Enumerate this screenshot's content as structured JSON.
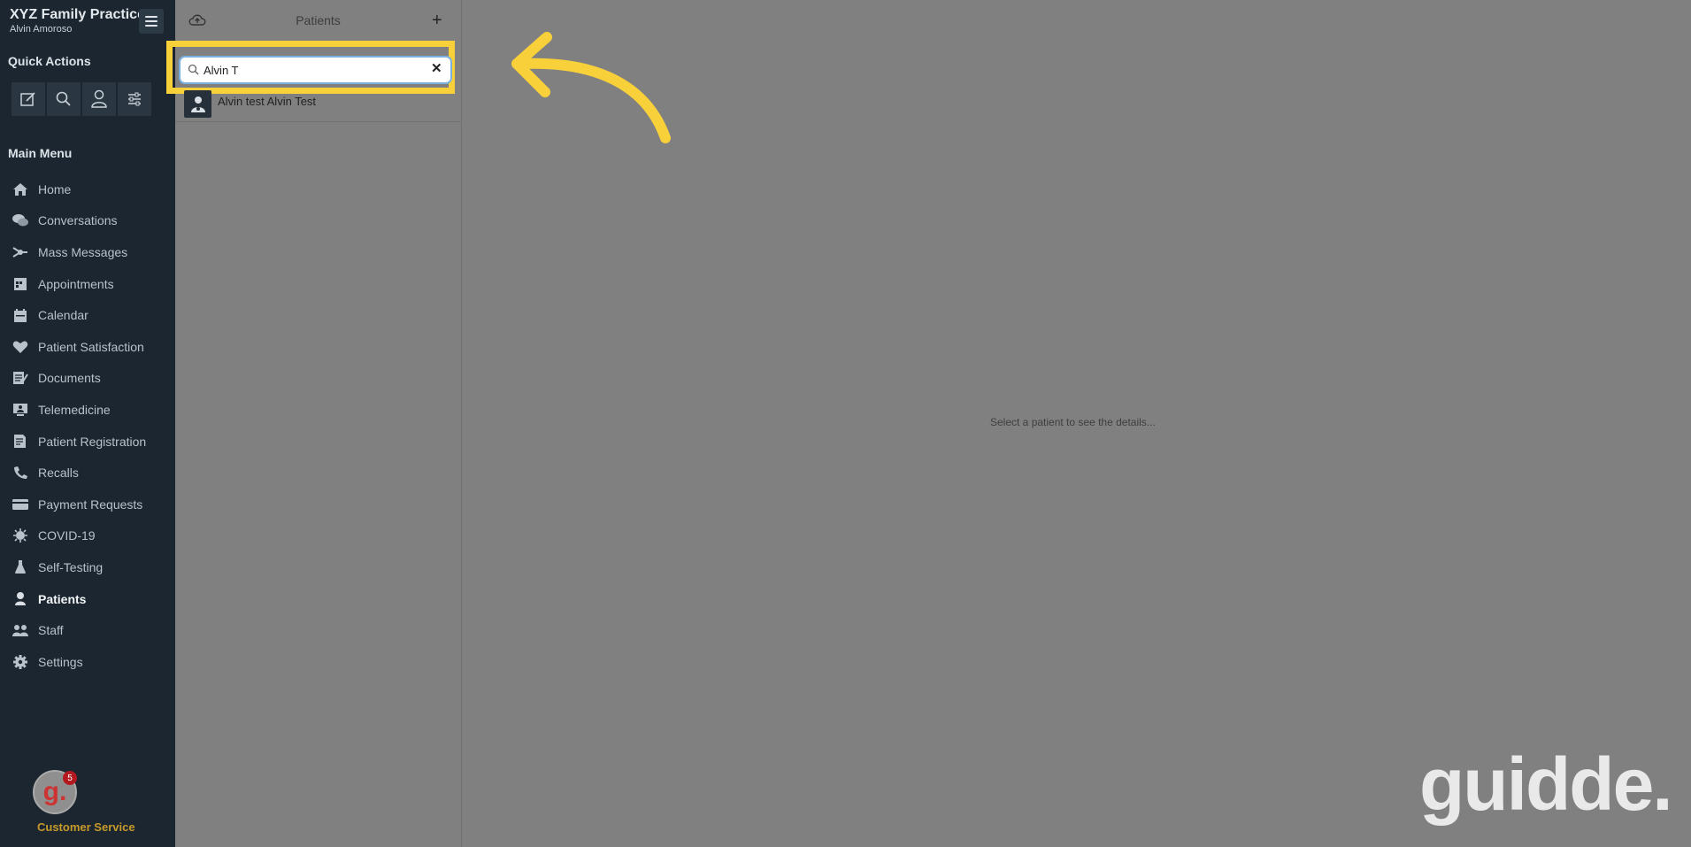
{
  "practice": {
    "name": "XYZ Family Practice",
    "user": "Alvin Amoroso"
  },
  "quick_actions": {
    "title": "Quick Actions",
    "icons": [
      "compose-icon",
      "search-icon",
      "patient-icon",
      "settings-sliders-icon"
    ]
  },
  "main_menu": {
    "title": "Main Menu",
    "items": [
      {
        "label": "Home",
        "icon": "home-icon"
      },
      {
        "label": "Conversations",
        "icon": "conversations-icon"
      },
      {
        "label": "Mass Messages",
        "icon": "mass-messages-icon"
      },
      {
        "label": "Appointments",
        "icon": "appointments-icon"
      },
      {
        "label": "Calendar",
        "icon": "calendar-icon"
      },
      {
        "label": "Patient Satisfaction",
        "icon": "heart-icon"
      },
      {
        "label": "Documents",
        "icon": "documents-icon"
      },
      {
        "label": "Telemedicine",
        "icon": "telemedicine-icon"
      },
      {
        "label": "Patient Registration",
        "icon": "registration-icon"
      },
      {
        "label": "Recalls",
        "icon": "phone-icon"
      },
      {
        "label": "Payment Requests",
        "icon": "credit-card-icon"
      },
      {
        "label": "COVID-19",
        "icon": "virus-icon"
      },
      {
        "label": "Self-Testing",
        "icon": "flask-icon"
      },
      {
        "label": "Patients",
        "icon": "patient-icon",
        "active": true
      },
      {
        "label": "Staff",
        "icon": "staff-icon"
      },
      {
        "label": "Settings",
        "icon": "gear-icon"
      }
    ]
  },
  "customer_service": {
    "label": "Customer Service",
    "badge": "5",
    "logo_letter": "g."
  },
  "patients_panel": {
    "title": "Patients",
    "add_label": "+",
    "search": {
      "value": "Alvin T",
      "clear_label": "✕"
    },
    "results": [
      {
        "name": "Alvin test Alvin Test"
      }
    ]
  },
  "detail_panel": {
    "empty_text": "Select a patient to see the details..."
  },
  "watermark": "guidde.",
  "colors": {
    "sidebar": "#1b2630",
    "overlay": "#808080",
    "highlight": "#f8d13a",
    "accent": "#c79a2a"
  }
}
